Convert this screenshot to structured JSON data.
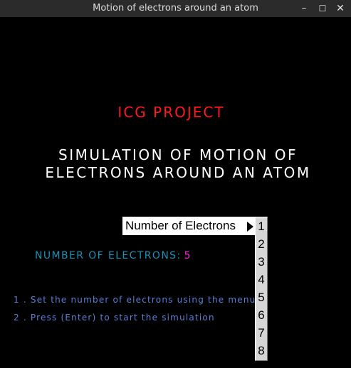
{
  "window": {
    "title": "Motion of electrons around an atom",
    "controls": {
      "minimize": "–",
      "maximize": "☐",
      "close": "✕"
    }
  },
  "project_title": "ICG PROJECT",
  "heading": {
    "line1": "SIMULATION OF MOTION OF",
    "line2": "ELECTRONS AROUND AN ATOM"
  },
  "electron_count": {
    "label": "NUMBER OF ELECTRONS:",
    "value": "5"
  },
  "instructions": [
    "1 . Set the number of electrons using the menu",
    "2 . Press (Enter) to start the simulation"
  ],
  "menu": {
    "item_label": "Number of Electrons",
    "options": [
      "1",
      "2",
      "3",
      "4",
      "5",
      "6",
      "7",
      "8"
    ]
  },
  "colors": {
    "background": "#000000",
    "project_title": "#ff1a1a",
    "heading": "#ffffff",
    "count_label": "#1e90b4",
    "count_value": "#ff2bd6",
    "instructions": "#5b80d8"
  }
}
